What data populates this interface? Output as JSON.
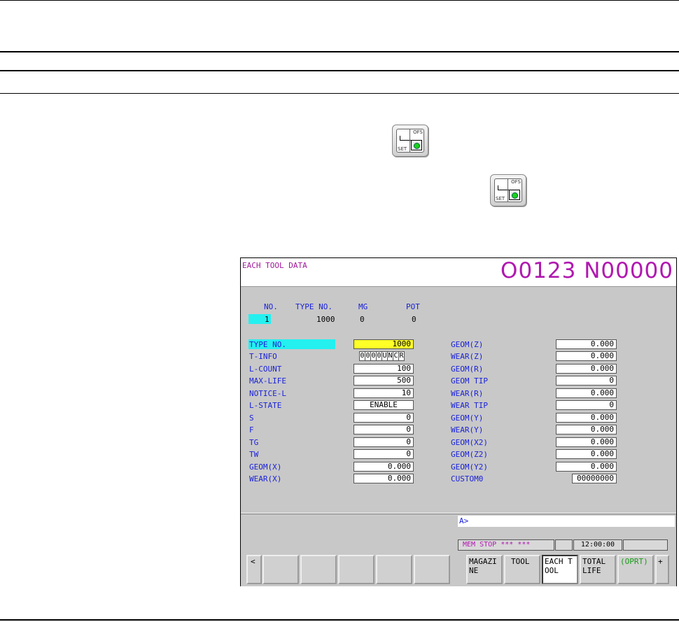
{
  "screen": {
    "title": "EACH TOOL DATA",
    "program": "O0123 N00000",
    "headers": {
      "no": "NO.",
      "type_no": "TYPE NO.",
      "mg": "MG",
      "pot": "POT"
    },
    "row": {
      "no": "1",
      "type_no": "1000",
      "mg": "0",
      "pot": "0"
    },
    "left_fields": [
      {
        "label": "TYPE NO.",
        "value": "1000"
      },
      {
        "label": "T-INFO",
        "value": ""
      },
      {
        "label": "L-COUNT",
        "value": "100"
      },
      {
        "label": "MAX-LIFE",
        "value": "500"
      },
      {
        "label": "NOTICE-L",
        "value": "10"
      },
      {
        "label": "L-STATE",
        "value": "ENABLE"
      },
      {
        "label": "S",
        "value": "0"
      },
      {
        "label": "F",
        "value": "0"
      },
      {
        "label": "TG",
        "value": "0"
      },
      {
        "label": "TW",
        "value": "0"
      },
      {
        "label": "GEOM(X)",
        "value": "0.000"
      },
      {
        "label": "WEAR(X)",
        "value": "0.000"
      }
    ],
    "tinfo_chars": [
      "0",
      "0",
      "0",
      "0",
      "U",
      "N",
      "C",
      "R"
    ],
    "right_fields": [
      {
        "label": "GEOM(Z)",
        "value": "0.000"
      },
      {
        "label": "WEAR(Z)",
        "value": "0.000"
      },
      {
        "label": "GEOM(R)",
        "value": "0.000"
      },
      {
        "label": "GEOM TIP",
        "value": "0"
      },
      {
        "label": "WEAR(R)",
        "value": "0.000"
      },
      {
        "label": "WEAR TIP",
        "value": "0"
      },
      {
        "label": "GEOM(Y)",
        "value": "0.000"
      },
      {
        "label": "WEAR(Y)",
        "value": "0.000"
      },
      {
        "label": "GEOM(X2)",
        "value": "0.000"
      },
      {
        "label": "GEOM(Z2)",
        "value": "0.000"
      },
      {
        "label": "GEOM(Y2)",
        "value": "0.000"
      },
      {
        "label": "CUSTOM0",
        "value": "00000000"
      }
    ],
    "input_prompt": "A>",
    "status": {
      "mode": "MEM",
      "state": "STOP",
      "stars": "*** ***",
      "time": "12:00:00"
    },
    "softkeys": {
      "left_arrow": "<",
      "magazine": "MAGAZI NE",
      "tool": "TOOL",
      "each_tool": "EACH T OOL",
      "total_life": "TOTAL LIFE",
      "oprt": "(OPRT)",
      "plus": "+"
    }
  },
  "icons": {
    "key_ofs": "OFS",
    "key_set": "SET"
  }
}
